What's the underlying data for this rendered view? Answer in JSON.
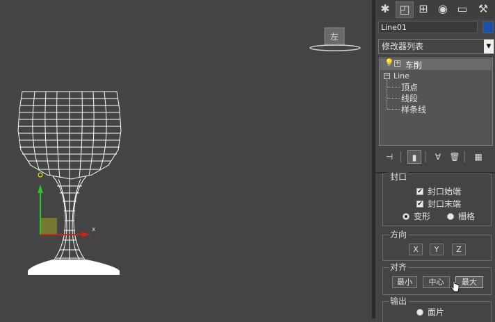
{
  "viewport": {
    "view_label": "左",
    "axis_x_label": "x"
  },
  "panel": {
    "tabs": [
      "create-icon",
      "modify-icon",
      "hierarchy-icon",
      "motion-icon",
      "display-icon",
      "utilities-icon"
    ],
    "object_name": "Line01",
    "object_color": "#1e4fa8",
    "modifier_list": {
      "selected": "修改器列表"
    },
    "stack": {
      "modifier": "车削",
      "base_object": "Line",
      "sub_objects": [
        "顶点",
        "线段",
        "样条线"
      ]
    },
    "rollout": {
      "cap_group": "封口",
      "cap_start": "封口始端",
      "cap_end": "封口末端",
      "morph": "变形",
      "grid": "栅格",
      "direction_group": "方向",
      "dir_x": "X",
      "dir_y": "Y",
      "dir_z": "Z",
      "align_group": "对齐",
      "align_min": "最小",
      "align_center": "中心",
      "align_max": "最大",
      "output_group": "输出",
      "patch": "面片"
    },
    "states": {
      "cap_start_checked": true,
      "cap_end_checked": true,
      "morph_selected": true
    }
  }
}
